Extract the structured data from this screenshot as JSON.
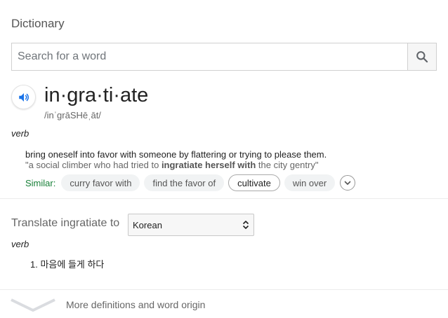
{
  "header": {
    "title": "Dictionary"
  },
  "search": {
    "placeholder": "Search for a word",
    "value": ""
  },
  "entry": {
    "word": "in·gra·ti·ate",
    "phonetic": "/inˈɡrāSHēˌāt/",
    "part_of_speech": "verb",
    "definition": "bring oneself into favor with someone by flattering or trying to please them.",
    "example_prefix": "\"a social climber who had tried to ",
    "example_bold": "ingratiate herself with",
    "example_suffix": " the city gentry\"",
    "similar_label": "Similar:",
    "similar": [
      "curry favor with",
      "find the favor of",
      "cultivate",
      "win over"
    ]
  },
  "translate": {
    "label": "Translate ingratiate to",
    "language": "Korean",
    "part_of_speech": "verb",
    "items": [
      "1. 마음에 들게 하다"
    ]
  },
  "footer": {
    "more_label": "More definitions and word origin"
  },
  "colors": {
    "similar_label": "#188038",
    "icon_blue": "#1a73e8"
  },
  "icons": [
    "search-icon",
    "speaker-icon",
    "chevron-down-icon",
    "select-arrows-icon"
  ]
}
